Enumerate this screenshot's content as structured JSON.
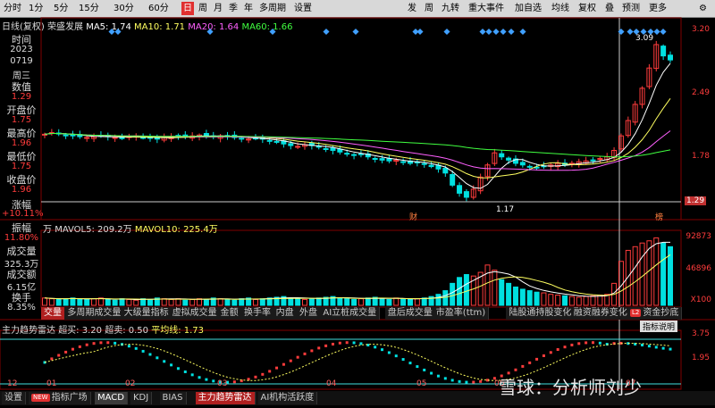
{
  "toolbar": {
    "left": [
      "分时",
      "1分",
      "5分",
      "15分",
      "30分",
      "60分",
      "日",
      "周",
      "月",
      "季",
      "年",
      "多周期",
      "设置"
    ],
    "active": "日",
    "right": [
      "发",
      "周",
      "九转",
      "重大事件",
      "加自选",
      "均线",
      "复权",
      "叠",
      "预测",
      "更多"
    ]
  },
  "legend_main": {
    "kind": "日线(复权)",
    "name": "荣盛发展",
    "ma5": "MA5: 1.74",
    "ma10": "MA10: 1.71",
    "ma20": "MA20: 1.64",
    "ma60": "MA60: 1.66"
  },
  "info": {
    "time_label": "时间",
    "date_year": "2023",
    "date_md": "0719",
    "weekday": "周三",
    "value_label": "数值",
    "value": "1.29",
    "open_label": "开盘价",
    "open": "1.75",
    "high_label": "最高价",
    "high": "1.96",
    "low_label": "最低价",
    "low": "1.75",
    "close_label": "收盘价",
    "close": "1.96",
    "change_label": "涨幅",
    "change": "+10.11%",
    "amplitude_label": "振幅",
    "amplitude": "11.80%",
    "volume_label": "成交量",
    "volume": "325.3万",
    "amount_label": "成交额",
    "amount": "6.15亿",
    "turnover_label": "换手",
    "turnover": "8.35%"
  },
  "price_axis": {
    "top": "3.20",
    "p2": "2.49",
    "p3": "1.78",
    "current": "1.29"
  },
  "annotations": {
    "high": "3.09",
    "low": "1.17",
    "marker_cai": "财",
    "marker_bang": "榜"
  },
  "legend_vol": {
    "unit": "万",
    "mavol5": "MAVOL5: 209.2万",
    "mavol10": "MAVOL10: 225.4万"
  },
  "vol_axis": {
    "top": "92873",
    "mid": "46896",
    "unit": "X100"
  },
  "bottom_tabs": [
    "交量",
    "多周期成交量",
    "大级量指标",
    "虚拟成交量",
    "金额",
    "换手率",
    "内盘",
    "外盘",
    "AI立桩成交量",
    "盘后成交量",
    "市盈率(ttm)",
    "陆股通持股变化",
    "融资融券变化",
    "资金抄底"
  ],
  "bottom_tab_badge": "L2",
  "legend_ind": {
    "name": "主力趋势雷达",
    "super_buy": "超买: 3.20",
    "super_sell": "超卖: 0.50",
    "avg": "平均线: 1.73"
  },
  "ind_axis": {
    "top": "3.75",
    "mid": "1.95"
  },
  "ind_help": "指标说明",
  "months": [
    "12",
    "01",
    "02",
    "03",
    "04",
    "05",
    "06",
    "07"
  ],
  "footer_tabs": [
    "设置",
    "指标广场",
    "MACD",
    "KDJ",
    "BIAS",
    "主力趋势雷达",
    "AI机构活跃度"
  ],
  "footer_new": "NEW",
  "watermark": "雪球：分析师刘少",
  "colors": {
    "up": "#ff3c3c",
    "down": "#00e0e0",
    "ma5": "#ffffff",
    "ma10": "#ffff60",
    "ma20": "#ff60ff",
    "ma60": "#40ff40"
  },
  "chart_data": {
    "type": "candlestick",
    "close_approx": [
      1.98,
      2.0,
      1.99,
      1.97,
      1.96,
      1.95,
      1.94,
      1.95,
      1.96,
      1.95,
      1.94,
      1.93,
      1.95,
      1.96,
      1.94,
      1.93,
      1.92,
      1.94,
      1.95,
      1.96,
      1.95,
      1.96,
      1.97,
      1.96,
      1.95,
      1.96,
      1.95,
      1.94,
      1.93,
      1.92,
      1.93,
      1.92,
      1.9,
      1.88,
      1.86,
      1.84,
      1.83,
      1.85,
      1.84,
      1.82,
      1.8,
      1.78,
      1.76,
      1.74,
      1.72,
      1.73,
      1.7,
      1.68,
      1.66,
      1.65,
      1.66,
      1.64,
      1.62,
      1.63,
      1.61,
      1.58,
      1.55,
      1.5,
      1.35,
      1.25,
      1.2,
      1.3,
      1.45,
      1.6,
      1.75,
      1.7,
      1.66,
      1.62,
      1.6,
      1.58,
      1.57,
      1.58,
      1.6,
      1.62,
      1.6,
      1.62,
      1.64,
      1.65,
      1.66,
      1.68,
      1.7,
      1.78,
      1.96,
      2.15,
      2.35,
      2.55,
      2.8,
      3.09,
      2.95,
      2.9
    ],
    "volume_approx": [
      10,
      9,
      8,
      9,
      10,
      9,
      8,
      9,
      10,
      8,
      7,
      9,
      8,
      7,
      9,
      8,
      10,
      9,
      8,
      9,
      7,
      8,
      9,
      8,
      10,
      9,
      8,
      7,
      9,
      10,
      8,
      9,
      10,
      11,
      12,
      10,
      9,
      8,
      9,
      10,
      11,
      12,
      10,
      9,
      8,
      9,
      10,
      11,
      9,
      8,
      10,
      9,
      8,
      9,
      10,
      12,
      15,
      20,
      30,
      38,
      42,
      40,
      45,
      55,
      48,
      35,
      30,
      25,
      22,
      20,
      18,
      17,
      15,
      14,
      13,
      12,
      11,
      12,
      13,
      14,
      15,
      30,
      60,
      75,
      80,
      85,
      88,
      92,
      85,
      80
    ]
  }
}
